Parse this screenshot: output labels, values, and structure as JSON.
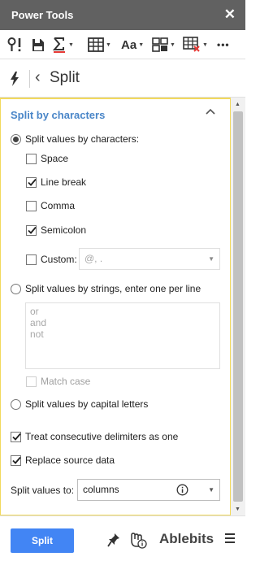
{
  "window": {
    "title": "Power Tools",
    "close_glyph": "✕"
  },
  "toolbar": {
    "items": [
      {
        "icon": "exclamation-find-icon"
      },
      {
        "icon": "save-export-icon"
      },
      {
        "icon": "sum-icon"
      },
      {
        "icon": "table-icon"
      },
      {
        "icon": "text-case-icon",
        "label": "Aa"
      },
      {
        "icon": "combine-icon"
      },
      {
        "icon": "remove-table-icon"
      },
      {
        "icon": "more-icon",
        "label": "•••"
      }
    ]
  },
  "header": {
    "page_title": "Split",
    "back_glyph": "‹"
  },
  "section": {
    "title": "Split by characters",
    "radio_characters": "Split values by characters:",
    "checkboxes": [
      {
        "label": "Space",
        "checked": false
      },
      {
        "label": "Line break",
        "checked": true
      },
      {
        "label": "Comma",
        "checked": false
      },
      {
        "label": "Semicolon",
        "checked": true
      }
    ],
    "custom": {
      "label": "Custom:",
      "value": "@, .",
      "checked": false
    },
    "radio_strings": "Split values by strings, enter one per line",
    "strings_lines": [
      "or",
      "and",
      "not"
    ],
    "match_case": "Match case",
    "radio_capital": "Split values by capital letters",
    "treat_consecutive": "Treat consecutive delimiters as one",
    "replace_source": "Replace source data",
    "split_to_label": "Split values to:",
    "split_to_value": "columns"
  },
  "footer": {
    "split_button": "Split",
    "brand": "Ablebits"
  },
  "colors": {
    "accent": "#4285f4",
    "section_title": "#4a86c8",
    "titlebar": "#616161",
    "panel_border": "#f2d95c"
  }
}
